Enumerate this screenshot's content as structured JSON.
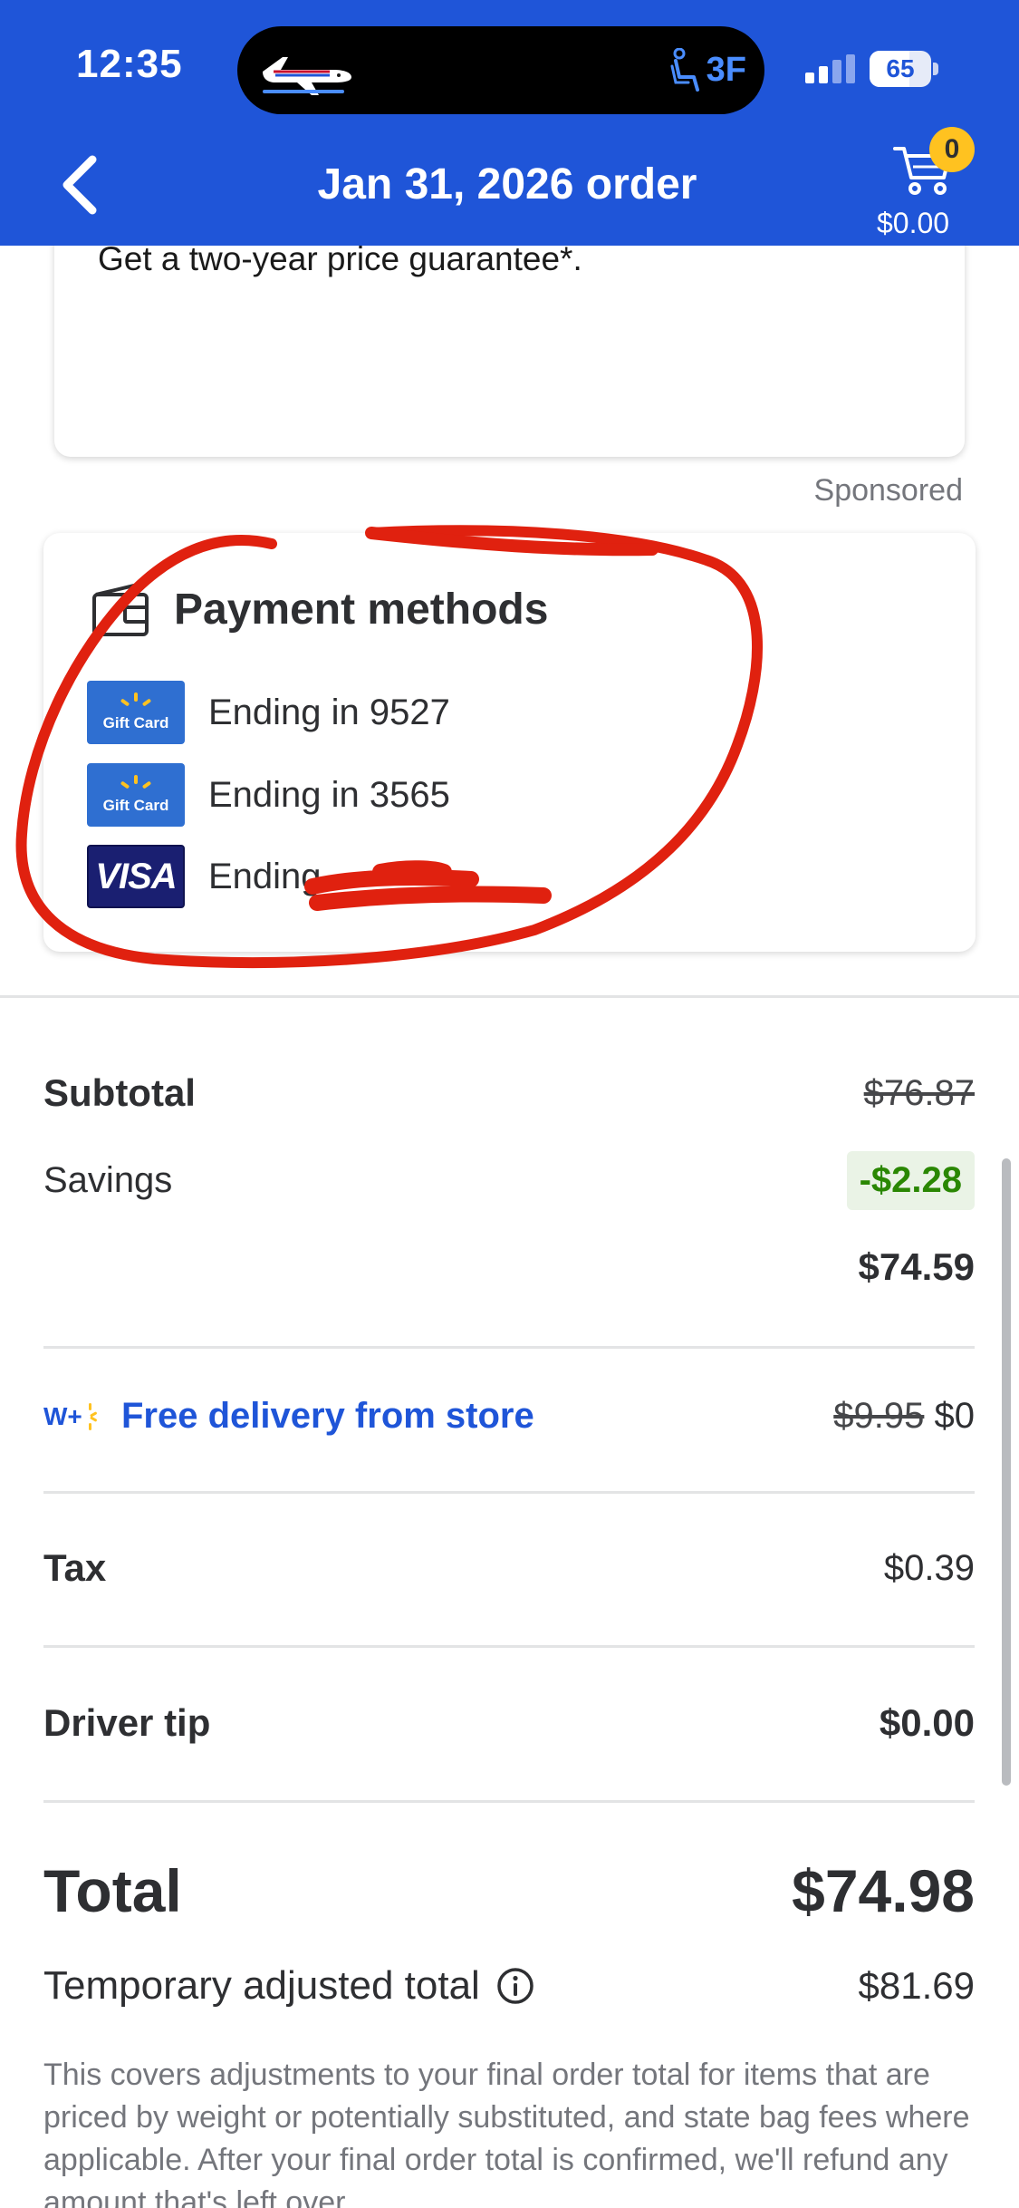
{
  "status_bar": {
    "time": "12:35",
    "seat": "3F",
    "battery": "65",
    "battery_level": 0.65
  },
  "header": {
    "title": "Jan 31, 2026 order",
    "cart_count": "0",
    "cart_total": "$0.00"
  },
  "promo": {
    "text": "Get a two-year price guarantee*.",
    "sponsored": "Sponsored"
  },
  "payment": {
    "title": "Payment methods",
    "methods": [
      {
        "type": "Gift Card",
        "label": "Ending in 9527"
      },
      {
        "type": "Gift Card",
        "label": "Ending in 3565"
      },
      {
        "type": "VISA",
        "label": "Ending"
      }
    ]
  },
  "summary": {
    "subtotal_label": "Subtotal",
    "subtotal_value": "$76.87",
    "savings_label": "Savings",
    "savings_value": "-$2.28",
    "after_savings": "$74.59",
    "delivery_label": "Free delivery from store",
    "delivery_original": "$9.95",
    "delivery_value": "$0",
    "tax_label": "Tax",
    "tax_value": "$0.39",
    "tip_label": "Driver tip",
    "tip_value": "$0.00",
    "total_label": "Total",
    "total_value": "$74.98",
    "temp_label": "Temporary adjusted total",
    "temp_value": "$81.69",
    "disclaimer": "This covers adjustments to your final order total for items that are priced by weight or potentially substituted, and state bag fees where applicable. After your final order total is confirmed, we'll refund any amount that's left over."
  },
  "colors": {
    "brand_blue": "#1f55d8",
    "spark_yellow": "#ffc220",
    "savings_green": "#2a8703",
    "annotation_red": "#e0210f"
  }
}
